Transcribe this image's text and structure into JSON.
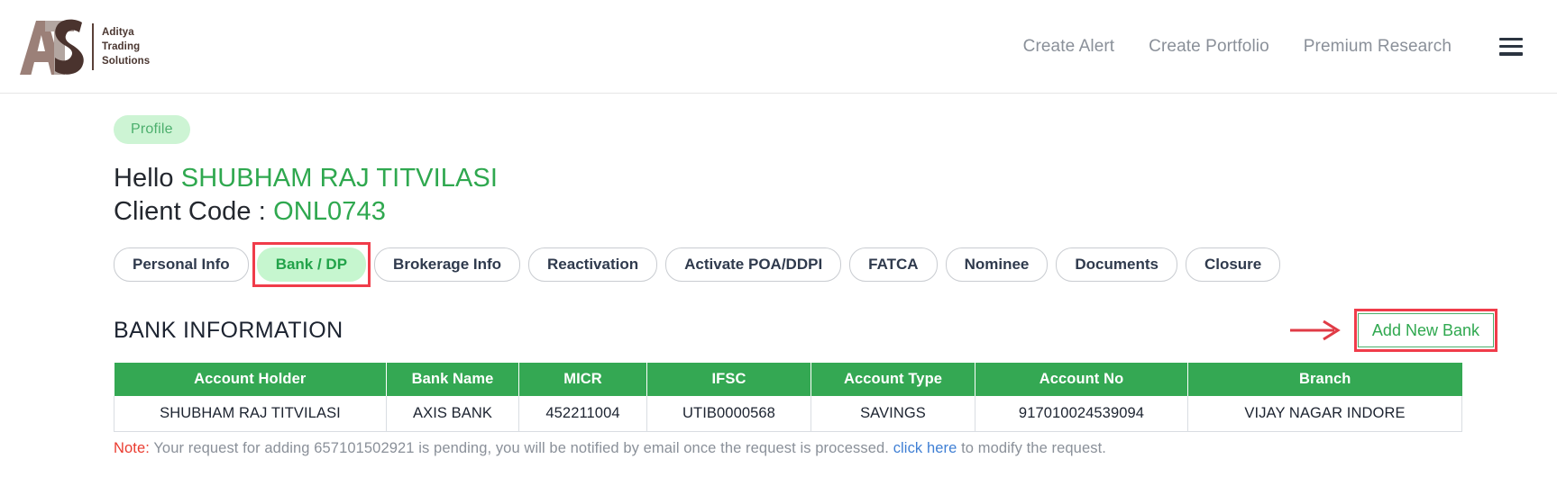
{
  "header": {
    "logo": {
      "monogram": "ATS",
      "line1": "Aditya",
      "line2": "Trading",
      "line3": "Solutions"
    },
    "nav": [
      {
        "label": "Create Alert"
      },
      {
        "label": "Create Portfolio"
      },
      {
        "label": "Premium Research"
      }
    ],
    "menu_icon": "hamburger-menu-icon"
  },
  "profile": {
    "badge": "Profile",
    "greeting_prefix": "Hello",
    "user_name": "SHUBHAM RAJ TITVILASI",
    "client_code_label": "Client Code :",
    "client_code_value": "ONL0743"
  },
  "tabs": [
    {
      "label": "Personal Info",
      "active": false
    },
    {
      "label": "Bank / DP",
      "active": true
    },
    {
      "label": "Brokerage Info",
      "active": false
    },
    {
      "label": "Reactivation",
      "active": false
    },
    {
      "label": "Activate POA/DDPI",
      "active": false
    },
    {
      "label": "FATCA",
      "active": false
    },
    {
      "label": "Nominee",
      "active": false
    },
    {
      "label": "Documents",
      "active": false
    },
    {
      "label": "Closure",
      "active": false
    }
  ],
  "section": {
    "title": "BANK INFORMATION",
    "add_button": "Add New Bank"
  },
  "table": {
    "columns": [
      "Account Holder",
      "Bank Name",
      "MICR",
      "IFSC",
      "Account Type",
      "Account No",
      "Branch"
    ],
    "rows": [
      [
        "SHUBHAM RAJ TITVILASI",
        "AXIS BANK",
        "452211004",
        "UTIB0000568",
        "SAVINGS",
        "917010024539094",
        "VIJAY NAGAR INDORE"
      ]
    ]
  },
  "note": {
    "label": "Note:",
    "text_before_link": "Your request for adding 657101502921 is pending, you will be notified by email once the request is processed.",
    "link": "click here",
    "text_after_link": "to modify the request."
  },
  "colors": {
    "brand_dark": "#5a4038",
    "brand_mid": "#8a6f66",
    "brand_light": "#b3a6a1",
    "accent_green": "#2fa84f",
    "table_header_green": "#34a853",
    "pill_green_bg": "#cdf4d4",
    "highlight_red": "#f03c4a",
    "note_red": "#ea3b2f",
    "link_blue": "#3f7fd4",
    "nav_gray": "#8a9099"
  }
}
